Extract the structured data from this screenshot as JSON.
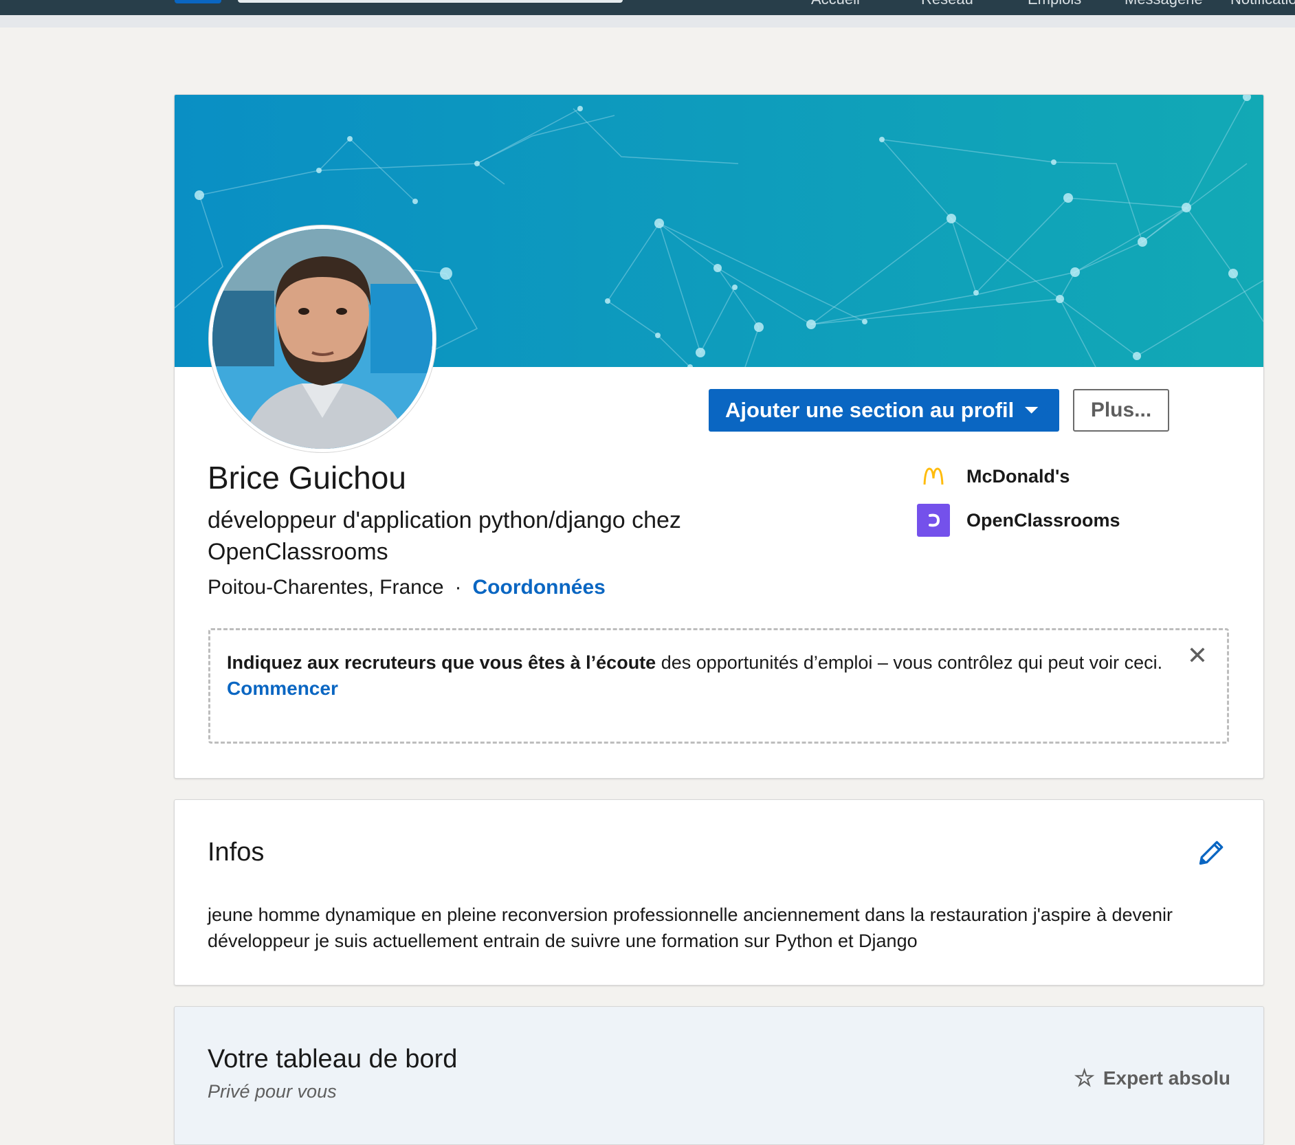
{
  "nav": {
    "items": [
      "Accueil",
      "Réseau",
      "Emplois",
      "Messagerie",
      "Notifications"
    ]
  },
  "profile": {
    "name": "Brice Guichou",
    "headline": "développeur d'application python/django chez OpenClassrooms",
    "location": "Poitou-Charentes, France",
    "separator": "·",
    "contact_link": "Coordonnées",
    "add_section_button": "Ajouter une section au profil",
    "more_button": "Plus...",
    "companies": [
      {
        "name": "McDonald's",
        "icon": "mcdonalds-logo",
        "color": "#ffbc0d"
      },
      {
        "name": "OpenClassrooms",
        "icon": "openclassrooms-logo",
        "color": "#7451eb"
      }
    ]
  },
  "open_to_work": {
    "lead": "Indiquez aux recruteurs que vous êtes à l’écoute",
    "rest": " des opportunités d’emploi – vous contrôlez qui peut voir ceci.",
    "cta": "Commencer",
    "close": "✕"
  },
  "infos": {
    "title": "Infos",
    "text": "jeune homme dynamique en pleine reconversion professionnelle anciennement dans la restauration j'aspire à devenir développeur je suis actuellement entrain de suivre une formation sur Python et Django"
  },
  "dashboard": {
    "title": "Votre tableau de bord",
    "subtitle": "Privé pour vous",
    "badge": "Expert absolu"
  },
  "colors": {
    "primary": "#0a66c2",
    "banner_start": "#0a8fc4",
    "banner_end": "#12a9b5"
  }
}
